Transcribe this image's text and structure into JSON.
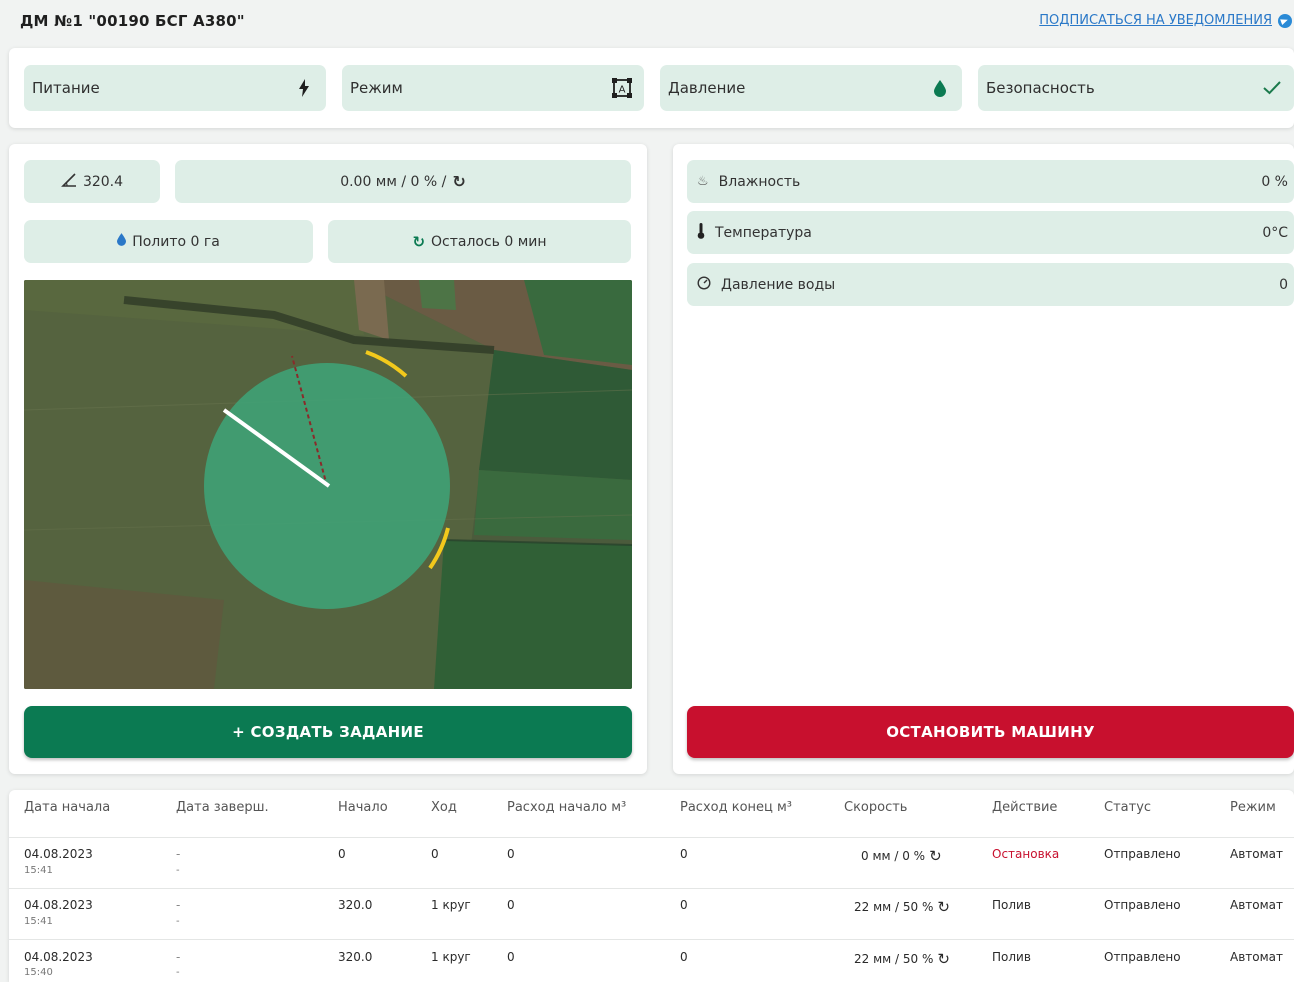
{
  "header": {
    "title": "ДМ №1 \"00190 БСГ А380\"",
    "subscribe_label": "ПОДПИСАТЬСЯ НА УВЕДОМЛЕНИЯ"
  },
  "status_pills": [
    {
      "label": "Питание",
      "icon": "lightning-icon"
    },
    {
      "label": "Режим",
      "icon": "mode-icon"
    },
    {
      "label": "Давление",
      "icon": "drop-icon"
    },
    {
      "label": "Безопасность",
      "icon": "check-icon"
    }
  ],
  "machine": {
    "angle": "320.4",
    "rate": "0.00 мм / 0 % /",
    "watered": "Полито 0 га",
    "remaining": "Осталось 0 мин",
    "create_task_label": "+ СОЗДАТЬ ЗАДАНИЕ",
    "stop_label": "ОСТАНОВИТЬ МАШИНУ"
  },
  "sensors": [
    {
      "label": "Влажность",
      "value": "0 %",
      "icon": "humidity-icon"
    },
    {
      "label": "Температура",
      "value": "0°C",
      "icon": "thermometer-icon"
    },
    {
      "label": "Давление воды",
      "value": "0",
      "icon": "gauge-icon"
    }
  ],
  "table": {
    "headers": [
      "Дата начала",
      "Дата заверш.",
      "Начало",
      "Ход",
      "Расход начало м³",
      "Расход конец м³",
      "Скорость",
      "Действие",
      "Статус",
      "Режим"
    ],
    "rows": [
      {
        "date": "04.08.2023",
        "time": "15:41",
        "end": "-",
        "end2": "-",
        "start": "0",
        "stroke": "0",
        "flow_start": "0",
        "flow_end": "0",
        "speed": "0 мм / 0 %",
        "action": "Остановка",
        "status": "Отправлено",
        "mode": "Автомат"
      },
      {
        "date": "04.08.2023",
        "time": "15:41",
        "end": "-",
        "end2": "-",
        "start": "320.0",
        "stroke": "1 круг",
        "flow_start": "0",
        "flow_end": "0",
        "speed": "22 мм / 50 %",
        "action": "Полив",
        "status": "Отправлено",
        "mode": "Автомат"
      },
      {
        "date": "04.08.2023",
        "time": "15:40",
        "end": "-",
        "end2": "-",
        "start": "320.0",
        "stroke": "1 круг",
        "flow_start": "0",
        "flow_end": "0",
        "speed": "22 мм / 50 %",
        "action": "Полив",
        "status": "Отправлено",
        "mode": "Автомат"
      }
    ]
  },
  "colors": {
    "pill_bg": "#deeee7",
    "primary_green": "#0b7a52",
    "danger_red": "#c8102e",
    "link_blue": "#2a78c8"
  }
}
